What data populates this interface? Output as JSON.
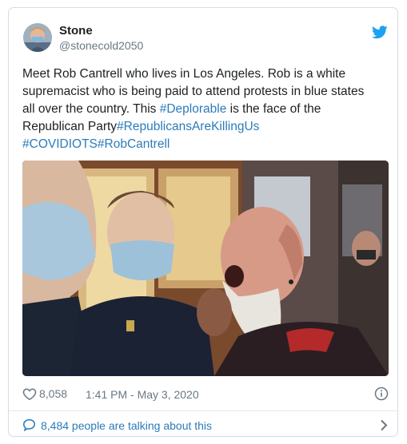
{
  "author": {
    "name": "Stone",
    "handle": "@stonecold2050"
  },
  "tweet": {
    "text_line1_prefix": "Meet Rob Cantrell who lives in Los Angeles. Rob is a white",
    "text_line2": "supremacist who is being paid to attend protests in blue states",
    "text_line3_prefix": "all over the country.  This ",
    "hashtag_deplorable": "#Deplorable",
    "text_line3_suffix": " is the face of the",
    "text_line4_prefix": "Republican Party",
    "hashtag_republicans": "#RepublicansAreKillingUs",
    "hashtag_covidiots": "#COVIDIOTS",
    "hashtag_robcantrell": "#RobCantrell"
  },
  "stats": {
    "likes": "8,058",
    "timestamp": "1:41 PM - May 3, 2020"
  },
  "footer": {
    "talking_text": "8,484 people are talking about this"
  },
  "icons": {
    "brand": "twitter-bird-icon",
    "like": "heart-icon",
    "info": "info-icon",
    "conversation": "speech-bubble-icon",
    "more": "chevron-right-icon"
  },
  "colors": {
    "link": "#2b7bb9",
    "twitter_blue": "#1da1f2",
    "secondary_text": "#697882",
    "border": "#d6dde3"
  }
}
